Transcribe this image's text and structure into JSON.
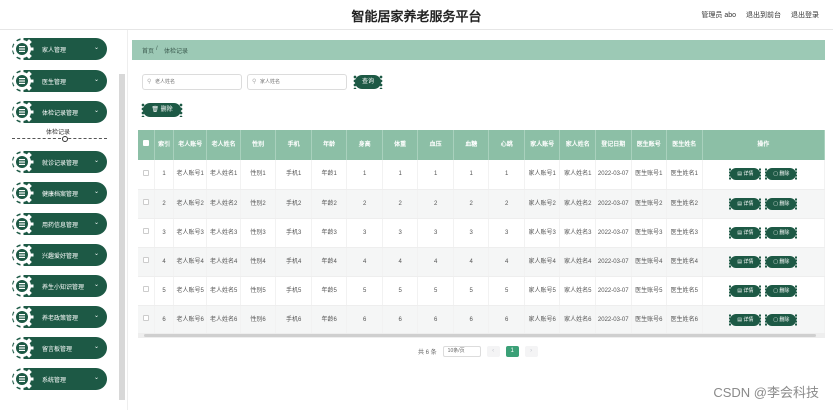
{
  "header": {
    "title": "智能居家养老服务平台",
    "user_label": "管理员 abo",
    "back_label": "退出到前台",
    "logout_label": "退出登录"
  },
  "sidebar": {
    "items": [
      {
        "label": "家人管理",
        "icon": "gear-icon"
      },
      {
        "label": "医生管理",
        "icon": "gear-icon"
      },
      {
        "label": "体检记录管理",
        "icon": "gear-icon"
      },
      {
        "label": "就诊记录管理",
        "icon": "gear-icon"
      },
      {
        "label": "健康档案管理",
        "icon": "gear-icon"
      },
      {
        "label": "用药信息管理",
        "icon": "gear-icon"
      },
      {
        "label": "兴趣爱好管理",
        "icon": "gear-icon"
      },
      {
        "label": "养生小知识管理",
        "icon": "gear-icon"
      },
      {
        "label": "养老政策管理",
        "icon": "gear-icon"
      },
      {
        "label": "留言板管理",
        "icon": "gear-icon"
      },
      {
        "label": "系统管理",
        "icon": "gear-icon"
      }
    ],
    "submenu_label": "体检记录"
  },
  "breadcrumb": {
    "home": "首页",
    "separator": "/",
    "current": "体检记录"
  },
  "search": {
    "name_placeholder": "老人姓名",
    "family_placeholder": "家人姓名",
    "query_label": "查询",
    "delete_label": "删除"
  },
  "table": {
    "headers": [
      "索引",
      "老人账号",
      "老人姓名",
      "性别",
      "手机",
      "年龄",
      "身高",
      "体重",
      "血压",
      "血糖",
      "心跳",
      "家人账号",
      "家人姓名",
      "登记日期",
      "医生账号",
      "医生姓名",
      "操作"
    ],
    "detail_label": "详情",
    "row_delete_label": "删除",
    "rows": [
      [
        "1",
        "老人账号1",
        "老人姓名1",
        "性别1",
        "手机1",
        "年龄1",
        "1",
        "1",
        "1",
        "1",
        "1",
        "家人账号1",
        "家人姓名1",
        "2022-03-07",
        "医生账号1",
        "医生姓名1"
      ],
      [
        "2",
        "老人账号2",
        "老人姓名2",
        "性别2",
        "手机2",
        "年龄2",
        "2",
        "2",
        "2",
        "2",
        "2",
        "家人账号2",
        "家人姓名2",
        "2022-03-07",
        "医生账号2",
        "医生姓名2"
      ],
      [
        "3",
        "老人账号3",
        "老人姓名3",
        "性别3",
        "手机3",
        "年龄3",
        "3",
        "3",
        "3",
        "3",
        "3",
        "家人账号3",
        "家人姓名3",
        "2022-03-07",
        "医生账号3",
        "医生姓名3"
      ],
      [
        "4",
        "老人账号4",
        "老人姓名4",
        "性别4",
        "手机4",
        "年龄4",
        "4",
        "4",
        "4",
        "4",
        "4",
        "家人账号4",
        "家人姓名4",
        "2022-03-07",
        "医生账号4",
        "医生姓名4"
      ],
      [
        "5",
        "老人账号5",
        "老人姓名5",
        "性别5",
        "手机5",
        "年龄5",
        "5",
        "5",
        "5",
        "5",
        "5",
        "家人账号5",
        "家人姓名5",
        "2022-03-07",
        "医生账号5",
        "医生姓名5"
      ],
      [
        "6",
        "老人账号6",
        "老人姓名6",
        "性别6",
        "手机6",
        "年龄6",
        "6",
        "6",
        "6",
        "6",
        "6",
        "家人账号6",
        "家人姓名6",
        "2022-03-07",
        "医生账号6",
        "医生姓名6"
      ]
    ]
  },
  "pagination": {
    "total": "共 6 条",
    "page_size": "10条/页",
    "current_page": "1",
    "prev": "‹",
    "next": "›"
  },
  "watermark": "CSDN @李会科技",
  "colors": {
    "primary": "#1d5945",
    "header": "#8cbfa6",
    "breadcrumb": "#9cc9b5"
  }
}
